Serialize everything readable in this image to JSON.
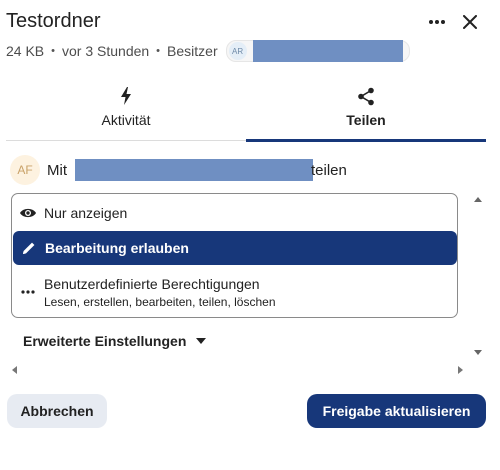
{
  "header": {
    "title": "Testordner",
    "more_icon": "more-horizontal-icon",
    "close_icon": "close-icon"
  },
  "meta": {
    "size": "24 KB",
    "separator": "•",
    "modified": "vor 3 Stunden",
    "owner_label": "Besitzer",
    "owner_initials": "AR"
  },
  "tabs": [
    {
      "label": "Aktivität",
      "icon": "activity-bolt-icon",
      "active": false
    },
    {
      "label": "Teilen",
      "icon": "share-icon",
      "active": true
    }
  ],
  "share": {
    "avatar_initials": "AF",
    "prefix": "Mit",
    "suffix": "teilen"
  },
  "permissions": {
    "options": [
      {
        "label": "Nur anzeigen",
        "icon": "eye-icon",
        "selected": false
      },
      {
        "label": "Bearbeitung erlauben",
        "icon": "pencil-icon",
        "selected": true
      },
      {
        "label": "Benutzerdefinierte Berechtigungen",
        "sublabel": "Lesen, erstellen, bearbeiten, teilen, löschen",
        "icon": "more-horizontal-icon",
        "selected": false
      }
    ]
  },
  "advanced": {
    "label": "Erweiterte Einstellungen"
  },
  "footer": {
    "cancel_label": "Abbrechen",
    "submit_label": "Freigabe aktualisieren"
  },
  "colors": {
    "accent": "#17377a",
    "redaction": "#6f8fc2",
    "cancel_bg": "#e7ebf2"
  }
}
